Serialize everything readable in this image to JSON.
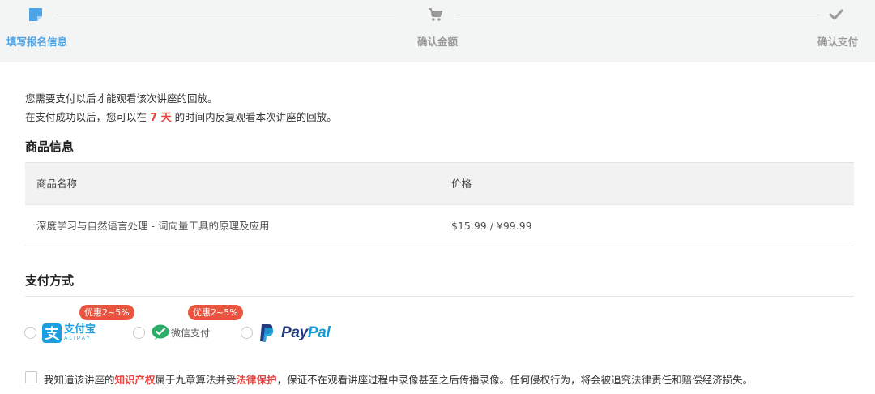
{
  "stepper": {
    "steps": [
      {
        "label": "填写报名信息",
        "icon": "form-icon",
        "state": "active"
      },
      {
        "label": "确认金额",
        "icon": "cart-icon",
        "state": "pending"
      },
      {
        "label": "确认支付",
        "icon": "check-icon",
        "state": "pending"
      }
    ],
    "active_color": "#4da3e8",
    "pending_color": "#999999"
  },
  "intro": {
    "line1": "您需要支付以后才能观看该次讲座的回放。",
    "line2_before": "在支付成功以后，您可以在",
    "line2_days": "7 天",
    "line2_after": "的时间内反复观看本次讲座的回放。"
  },
  "product_section": {
    "title": "商品信息",
    "headers": {
      "name": "商品名称",
      "price": "价格"
    },
    "rows": [
      {
        "name": "深度学习与自然语言处理 - 词向量工具的原理及应用",
        "price": "$15.99 / ¥99.99"
      }
    ]
  },
  "payment_section": {
    "title": "支付方式",
    "methods": [
      {
        "id": "alipay",
        "badge": "优惠2~5%",
        "logo_text": "支付宝",
        "logo_sub": "ALIPAY",
        "icon": "alipay-icon",
        "color": "#1b9fe0"
      },
      {
        "id": "wechat",
        "badge": "优惠2~5%",
        "logo_text": "微信支付",
        "icon": "wechat-pay-icon",
        "color": "#2aae67"
      },
      {
        "id": "paypal",
        "logo_text_1": "Pay",
        "logo_text_2": "Pal",
        "icon": "paypal-icon",
        "color_dark": "#253b80",
        "color_light": "#179bd7"
      }
    ]
  },
  "agreement": {
    "part1": "我知道该讲座的",
    "highlight1": "知识产权",
    "part2": "属于九章算法并受",
    "highlight2": "法律保护",
    "part3": "，保证不在观看讲座过程中录像甚至之后传播录像。任何侵权行为，将会被追究法律责任和赔偿经济损失。",
    "highlight_color": "#e64340"
  }
}
